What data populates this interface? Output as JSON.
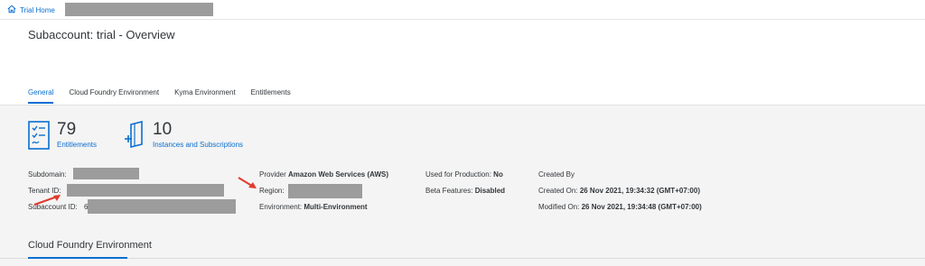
{
  "breadcrumb": {
    "home_label": "Trial Home"
  },
  "header": {
    "title": "Subaccount: trial - Overview",
    "tabs": [
      {
        "label": "General",
        "active": true
      },
      {
        "label": "Cloud Foundry Environment",
        "active": false
      },
      {
        "label": "Kyma Environment",
        "active": false
      },
      {
        "label": "Entitlements",
        "active": false
      }
    ]
  },
  "kpis": [
    {
      "value": "79",
      "label": "Entitlements",
      "icon": "entitlements-icon"
    },
    {
      "value": "10",
      "label": "Instances and Subscriptions",
      "icon": "instances-icon"
    }
  ],
  "details": {
    "col1": {
      "subdomain_label": "Subdomain:",
      "tenant_label": "Tenant ID:",
      "subaccount_label": "Subaccount ID:",
      "subaccount_prefix": "6"
    },
    "col2": {
      "provider_label": "Provider",
      "provider_value": "Amazon Web Services (AWS)",
      "region_label": "Region:",
      "environment_label": "Environment:",
      "environment_value": "Multi-Environment"
    },
    "col3": {
      "production_label": "Used for Production:",
      "production_value": "No",
      "beta_label": "Beta Features:",
      "beta_value": "Disabled"
    },
    "col4": {
      "created_by_label": "Created By",
      "created_on_label": "Created On:",
      "created_on_value": "26 Nov 2021, 19:34:32 (GMT+07:00)",
      "modified_on_label": "Modified On:",
      "modified_on_value": "26 Nov 2021, 19:34:48 (GMT+07:00)"
    }
  },
  "section": {
    "title": "Cloud Foundry Environment"
  },
  "colors": {
    "accent": "#0a6ed1",
    "arrow": "#e03a2f",
    "mask": "#9c9c9c"
  }
}
